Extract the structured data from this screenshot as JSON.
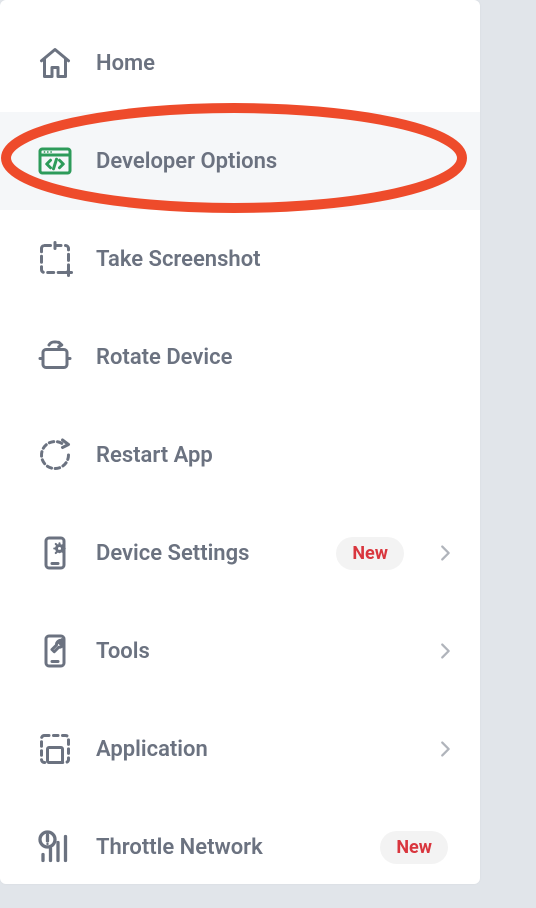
{
  "menu": {
    "items": [
      {
        "label": "Home",
        "icon": "home-icon",
        "selected": false,
        "badge": "",
        "chevron": false
      },
      {
        "label": "Developer Options",
        "icon": "code-window-icon",
        "selected": true,
        "badge": "",
        "chevron": false
      },
      {
        "label": "Take Screenshot",
        "icon": "screenshot-icon",
        "selected": false,
        "badge": "",
        "chevron": false
      },
      {
        "label": "Rotate Device",
        "icon": "rotate-icon",
        "selected": false,
        "badge": "",
        "chevron": false
      },
      {
        "label": "Restart App",
        "icon": "restart-icon",
        "selected": false,
        "badge": "",
        "chevron": false
      },
      {
        "label": "Device Settings",
        "icon": "device-settings-icon",
        "selected": false,
        "badge": "New",
        "chevron": true
      },
      {
        "label": "Tools",
        "icon": "tools-icon",
        "selected": false,
        "badge": "",
        "chevron": true
      },
      {
        "label": "Application",
        "icon": "application-icon",
        "selected": false,
        "badge": "",
        "chevron": true
      },
      {
        "label": "Throttle Network",
        "icon": "throttle-icon",
        "selected": false,
        "badge": "New",
        "chevron": false
      }
    ]
  },
  "annotation": {
    "type": "ellipse",
    "color": "#ee4b2b",
    "target_index": 1
  }
}
